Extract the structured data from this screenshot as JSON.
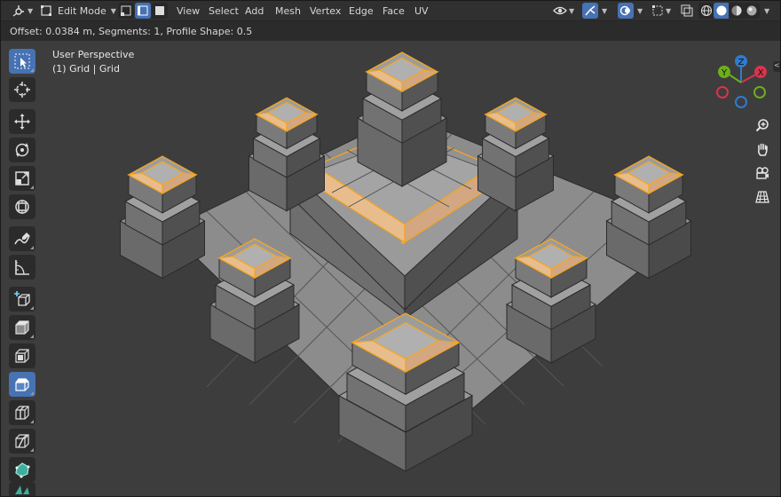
{
  "header": {
    "mode_label": "Edit Mode",
    "menus": [
      "View",
      "Select",
      "Add",
      "Mesh",
      "Vertex",
      "Edge",
      "Face",
      "UV"
    ]
  },
  "redo_panel": {
    "text": "Offset: 0.0384 m, Segments: 1, Profile Shape: 0.5"
  },
  "viewport": {
    "perspective_label": "User Perspective",
    "object_label": "(1) Grid | Grid",
    "gizmo": {
      "x": "X",
      "y": "Y",
      "z": "Z"
    }
  },
  "tools": [
    {
      "name": "select-box-tool",
      "icon": "select-box-icon"
    },
    {
      "name": "cursor-tool",
      "icon": "cursor-icon"
    },
    {
      "name": "move-tool",
      "icon": "move-icon"
    },
    {
      "name": "rotate-tool",
      "icon": "rotate-icon"
    },
    {
      "name": "scale-tool",
      "icon": "scale-icon"
    },
    {
      "name": "transform-tool",
      "icon": "transform-icon"
    },
    {
      "name": "annotate-tool",
      "icon": "annotate-icon"
    },
    {
      "name": "measure-tool",
      "icon": "measure-icon"
    },
    {
      "name": "add-cube-tool",
      "icon": "add-cube-icon"
    },
    {
      "name": "extrude-tool",
      "icon": "extrude-icon"
    },
    {
      "name": "inset-tool",
      "icon": "inset-icon"
    },
    {
      "name": "bevel-tool",
      "icon": "bevel-icon"
    },
    {
      "name": "loop-cut-tool",
      "icon": "loop-cut-icon"
    },
    {
      "name": "knife-tool",
      "icon": "knife-icon"
    },
    {
      "name": "poly-build-tool",
      "icon": "poly-build-icon"
    },
    {
      "name": "spin-tool",
      "icon": "spin-icon"
    }
  ],
  "colors": {
    "accent": "#4772b3",
    "selection": "#f5a623",
    "header_bg": "#303030",
    "viewport_bg": "#3d3d3d"
  }
}
